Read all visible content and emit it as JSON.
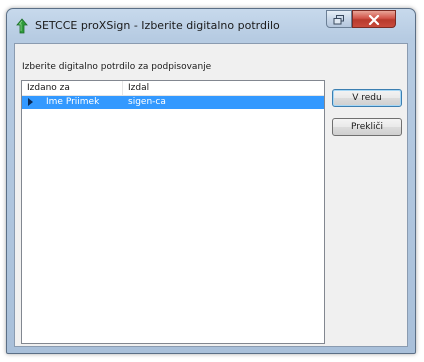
{
  "window": {
    "title": "SETCCE proXSign - Izberite digitalno potrdilo"
  },
  "dialog": {
    "instruction": "Izberite digitalno potrdilo za podpisovanje",
    "columns": [
      "Izdano za",
      "Izdal"
    ],
    "rows": [
      {
        "issued_to": "Ime Priimek",
        "issuer": "sigen-ca",
        "selected": true
      }
    ],
    "ok_label": "V redu",
    "cancel_label": "Prekliči"
  },
  "icons": {
    "app": "proxsign-logo-icon",
    "restore": "restore-icon",
    "close": "close-icon",
    "row_marker": "row-selector-arrow-icon"
  },
  "colors": {
    "selection": "#3399ff",
    "close_button": "#c94b3c",
    "title_bar": "#b6cbe2"
  }
}
